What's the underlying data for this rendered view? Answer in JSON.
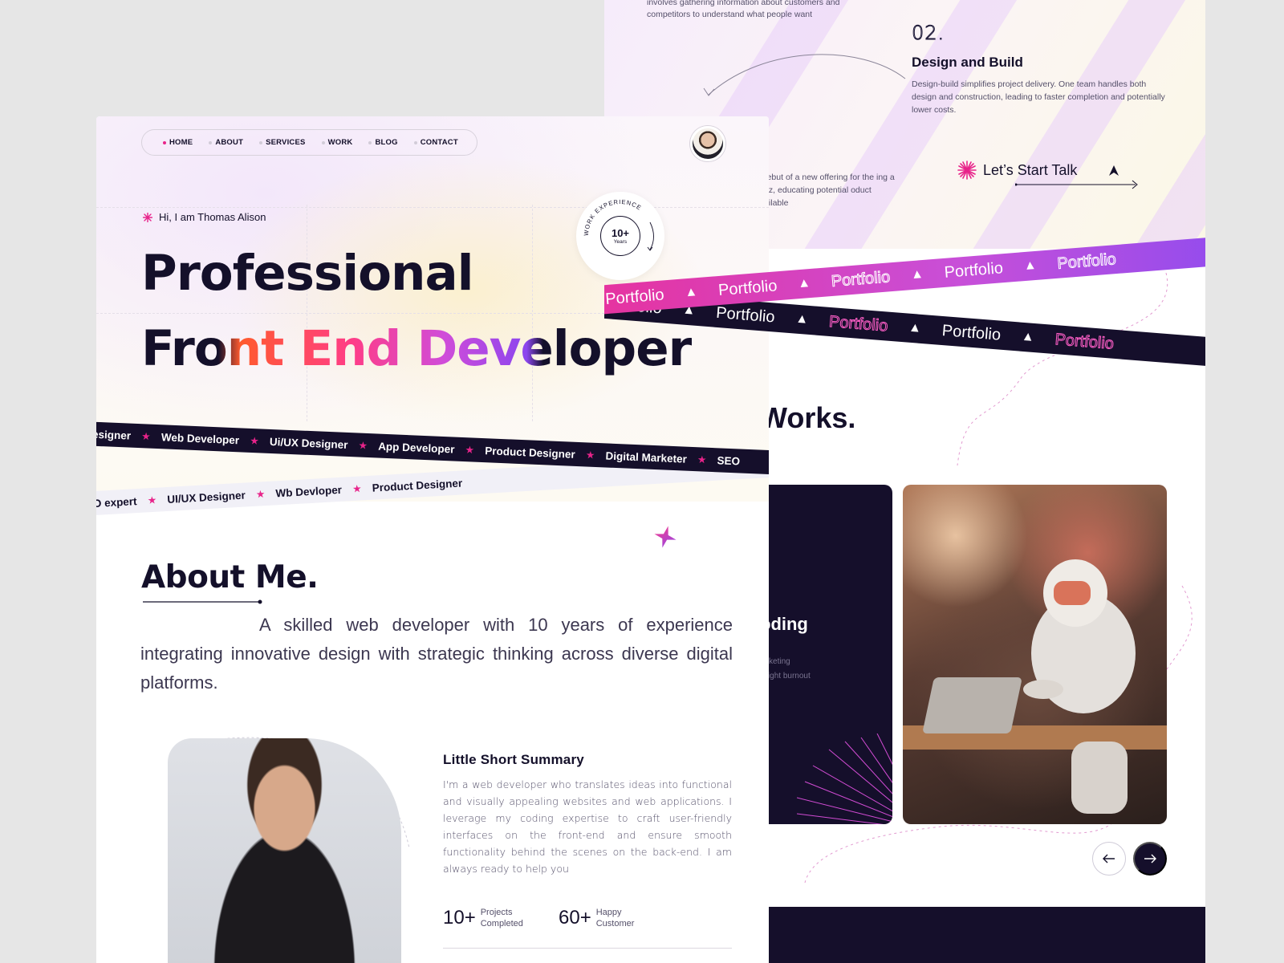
{
  "back_panel": {
    "intro_text": "involves gathering information about customers and competitors to understand what people want",
    "step": {
      "number": "02.",
      "title": "Design and Build",
      "description": "Design-build simplifies project delivery. One team handles both design and construction, leading to faster completion and potentially lower costs."
    },
    "launch_text": "g debut of a new offering for the ing a buzz, educating potential oduct available",
    "cta_label": "Let’s Start Talk",
    "ribbon_word": "Portfolio",
    "works_title": "Works.",
    "card": {
      "title": "rning\nor Coding",
      "subtitle": "n- Profit Marketing\nemployees fight burnout"
    },
    "colors": {
      "dark": "#150f2b",
      "pink": "#e6339f",
      "purple": "#8d4cf0"
    }
  },
  "front_panel": {
    "nav": {
      "items": [
        "HOME",
        "ABOUT",
        "SERVICES",
        "WORK",
        "BLOG",
        "CONTACT"
      ],
      "active": "HOME"
    },
    "greeting": "Hi, I am Thomas Alison",
    "hero_line1": "Professional",
    "hero_line2": "Front End Developer",
    "badge": {
      "value": "10+",
      "unit": "Years",
      "ring_text": "WORK EXPERIENCE"
    },
    "tags_dark": [
      "Designer",
      "Web Developer",
      "Ui/UX Designer",
      "App Developer",
      "Product Designer",
      "Digital Marketer",
      "SEO"
    ],
    "tags_light": [
      "EO expert",
      "UI/UX Designer",
      "Wb Devloper",
      "Product Designer"
    ],
    "about": {
      "title": "About Me.",
      "text": "A skilled web developer with 10 years of experience integrating innovative design with strategic thinking across diverse digital platforms."
    },
    "summary": {
      "title": "Little Short Summary",
      "text": "I'm a web developer who translates ideas into functional and visually appealing websites and web applications. I leverage my coding expertise to craft user-friendly interfaces on the front-end and ensure smooth functionality behind the scenes on the back-end. I am always ready to help you"
    },
    "stats": [
      {
        "value": "10+",
        "label": "Projects\nCompleted"
      },
      {
        "value": "60+",
        "label": "Happy\nCustomer"
      }
    ],
    "colors": {
      "accent": "#e8238a",
      "text": "#14102a"
    }
  }
}
